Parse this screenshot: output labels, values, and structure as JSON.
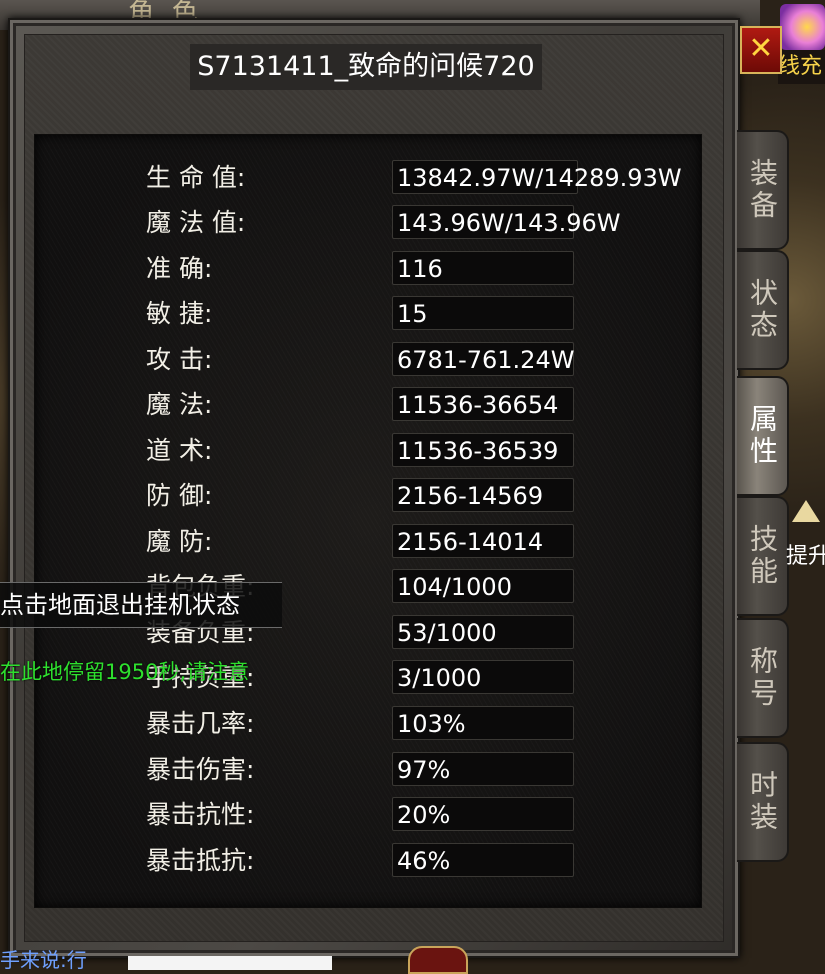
{
  "window": {
    "top_label": "角色",
    "title": "S7131411_致命的问候720"
  },
  "stats": [
    {
      "label": "生 命 值:",
      "value": "13842.97W/14289.93W"
    },
    {
      "label": "魔 法 值:",
      "value": "143.96W/143.96W"
    },
    {
      "label": "准      确:",
      "value": "116"
    },
    {
      "label": "敏      捷:",
      "value": "15"
    },
    {
      "label": "攻      击:",
      "value": "6781-761.24W"
    },
    {
      "label": "魔      法:",
      "value": "11536-36654"
    },
    {
      "label": "道      术:",
      "value": "11536-36539"
    },
    {
      "label": "防      御:",
      "value": "2156-14569"
    },
    {
      "label": "魔      防:",
      "value": "2156-14014"
    },
    {
      "label": "背包负重:",
      "value": "104/1000"
    },
    {
      "label": "装备负重:",
      "value": "53/1000"
    },
    {
      "label": "手持负重:",
      "value": "3/1000"
    },
    {
      "label": "暴击几率:",
      "value": "103%"
    },
    {
      "label": "暴击伤害:",
      "value": "97%"
    },
    {
      "label": "暴击抗性:",
      "value": "20%"
    },
    {
      "label": "暴击抵抗:",
      "value": "46%"
    }
  ],
  "tabs": [
    {
      "label": "装备",
      "active": false
    },
    {
      "label": "状态",
      "active": false
    },
    {
      "label": "属性",
      "active": true
    },
    {
      "label": "技能",
      "active": false
    },
    {
      "label": "称号",
      "active": false
    },
    {
      "label": "时装",
      "active": false
    }
  ],
  "close_label": "✕",
  "hud": {
    "banner_text": "线充",
    "upgrade_text": "提升",
    "hint_text": "点击地面退出挂机状态",
    "warning_text": "在此地停留1950秒,请注意",
    "chat_text": "手来说:行"
  },
  "colors": {
    "warning": "#2ee02e",
    "close_button": "#b01a12",
    "value_text": "#ffffff"
  }
}
